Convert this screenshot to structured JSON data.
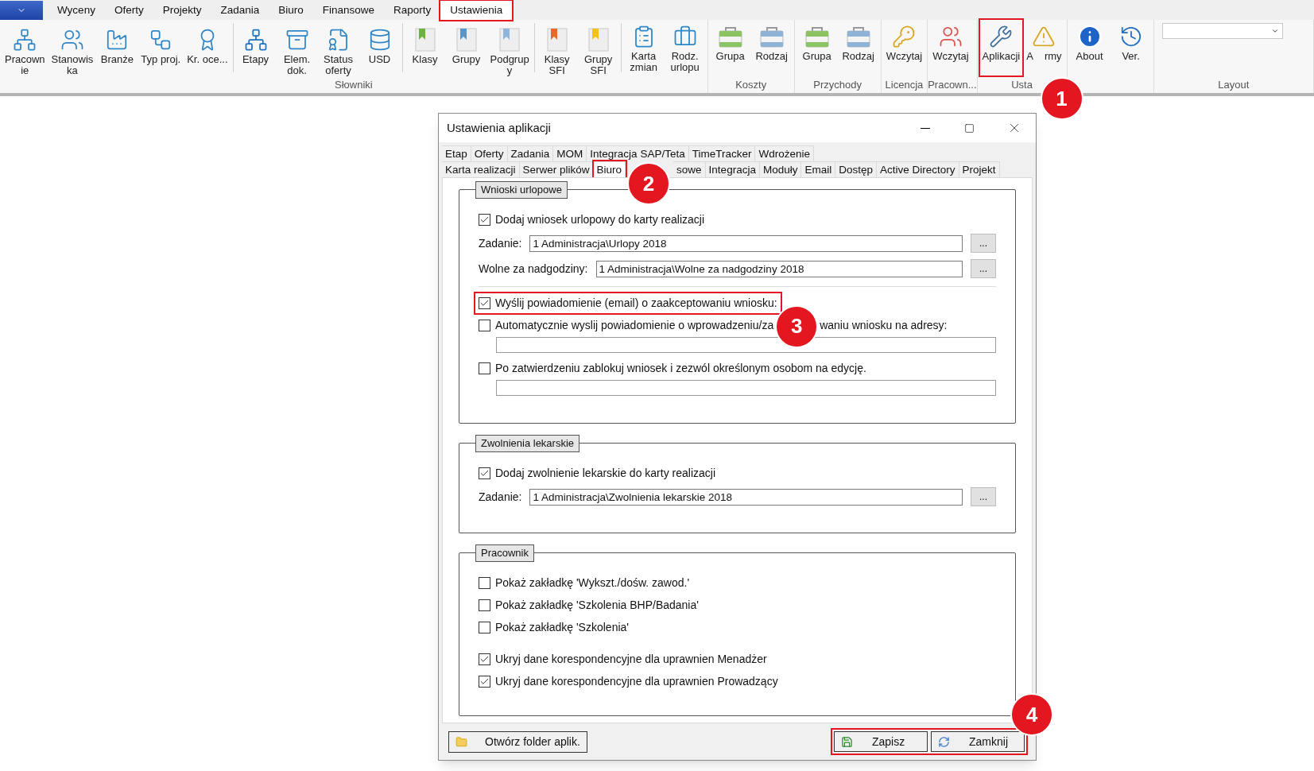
{
  "menu": {
    "tabs": [
      {
        "label": "Wyceny",
        "selected": false,
        "highlighted": false
      },
      {
        "label": "Oferty",
        "selected": false,
        "highlighted": false
      },
      {
        "label": "Projekty",
        "selected": false,
        "highlighted": false
      },
      {
        "label": "Zadania",
        "selected": false,
        "highlighted": false
      },
      {
        "label": "Biuro",
        "selected": false,
        "highlighted": false
      },
      {
        "label": "Finansowe",
        "selected": false,
        "highlighted": false
      },
      {
        "label": "Raporty",
        "selected": false,
        "highlighted": false
      },
      {
        "label": "Ustawienia",
        "selected": true,
        "highlighted": true
      }
    ]
  },
  "ribbon": {
    "groups": [
      {
        "label": "Słowniki",
        "subgroups": [
          [
            {
              "label": "Pracown\nie",
              "highlighted": false
            },
            {
              "label": "Stanowis\nka",
              "highlighted": false
            },
            {
              "label": "Branże",
              "highlighted": false
            },
            {
              "label": "Typ proj.",
              "highlighted": false
            },
            {
              "label": "Kr. oce...",
              "highlighted": false
            }
          ],
          [
            {
              "label": "Etapy",
              "highlighted": false
            },
            {
              "label": "Elem.\ndok.",
              "highlighted": false
            },
            {
              "label": "Status\noferty",
              "highlighted": false
            },
            {
              "label": "USD",
              "highlighted": false
            }
          ],
          [
            {
              "label": "Klasy",
              "highlighted": false
            },
            {
              "label": "Grupy",
              "highlighted": false
            },
            {
              "label": "Podgrup\ny",
              "highlighted": false
            }
          ],
          [
            {
              "label": "Klasy\nSFI",
              "highlighted": false
            },
            {
              "label": "Grupy\nSFI",
              "highlighted": false
            }
          ],
          [
            {
              "label": "Karta\nzmian",
              "highlighted": false
            },
            {
              "label": "Rodz.\nurlopu",
              "highlighted": false
            }
          ]
        ]
      },
      {
        "label": "Koszty",
        "subgroups": [
          [
            {
              "label": "Grupa",
              "highlighted": false
            },
            {
              "label": "Rodzaj",
              "highlighted": false
            }
          ]
        ]
      },
      {
        "label": "Przychody",
        "subgroups": [
          [
            {
              "label": "Grupa",
              "highlighted": false
            },
            {
              "label": "Rodzaj",
              "highlighted": false
            }
          ]
        ]
      },
      {
        "label": "Licencja",
        "subgroups": [
          [
            {
              "label": "Wczytaj",
              "highlighted": false
            }
          ]
        ]
      },
      {
        "label": "Pracown...",
        "subgroups": [
          [
            {
              "label": "Wczytaj",
              "highlighted": false
            }
          ]
        ]
      },
      {
        "label": "Usta",
        "subgroups": [
          [
            {
              "label": "Aplikacji",
              "highlighted": true,
              "callout": "1"
            },
            {
              "label_parts": [
                "A",
                "rmy"
              ],
              "highlighted": false
            }
          ]
        ]
      },
      {
        "subgroups": [
          [
            {
              "label": "About",
              "highlighted": false
            },
            {
              "label": "Ver.",
              "highlighted": false
            }
          ]
        ]
      },
      {
        "label": "Layout",
        "combo": true
      }
    ]
  },
  "dialog": {
    "title": "Ustawienia aplikacji",
    "tab_rows": [
      [
        {
          "label": "Etap",
          "selected": false,
          "highlighted": false
        },
        {
          "label": "Oferty",
          "selected": false,
          "highlighted": false
        },
        {
          "label": "Zadania",
          "selected": false,
          "highlighted": false
        },
        {
          "label": "MOM",
          "selected": false,
          "highlighted": false
        },
        {
          "label": "Integracja SAP/Teta",
          "selected": false,
          "highlighted": false
        },
        {
          "label": "TimeTracker",
          "selected": false,
          "highlighted": false
        },
        {
          "label": "Wdrożenie",
          "selected": false,
          "highlighted": false
        }
      ],
      [
        {
          "label": "Karta realizacji",
          "selected": false,
          "highlighted": false
        },
        {
          "label": "Serwer plików",
          "selected": false,
          "highlighted": false
        },
        {
          "label": "Biuro",
          "selected": true,
          "highlighted": true
        },
        {
          "label": "sowe",
          "selected": false,
          "highlighted": false,
          "callout": "2"
        },
        {
          "label": "Integracja",
          "selected": false,
          "highlighted": false
        },
        {
          "label": "Moduły",
          "selected": false,
          "highlighted": false
        },
        {
          "label": "Email",
          "selected": false,
          "highlighted": false
        },
        {
          "label": "Dostęp",
          "selected": false,
          "highlighted": false
        },
        {
          "label": "Active Directory",
          "selected": false,
          "highlighted": false
        },
        {
          "label": "Projekt",
          "selected": false,
          "highlighted": false
        }
      ]
    ],
    "groups": [
      {
        "title": "Wnioski urlopowe",
        "rows": [
          {
            "kind": "checkbox",
            "label": "Dodaj wniosek urlopowy do karty realizacji",
            "checked": true,
            "highlighted": false
          },
          {
            "kind": "field",
            "label": "Zadanie:",
            "value": "1 Administracja\\Urlopy 2018",
            "button": "..."
          },
          {
            "kind": "field",
            "label": "Wolne za nadgodziny:",
            "value": "1 Administracja\\Wolne za nadgodziny 2018",
            "button": "..."
          },
          {
            "kind": "divider"
          },
          {
            "kind": "checkbox",
            "label": "Wyślij powiadomienie (email) o zaakceptowaniu wniosku:",
            "checked": true,
            "highlighted": true
          },
          {
            "kind": "checkbox",
            "label_parts": [
              "Automatycznie wyslij powiadomienie o wprowadzeniu/za",
              "waniu wniosku na adresy:"
            ],
            "callout": "3",
            "checked": false,
            "highlighted": false
          },
          {
            "kind": "input"
          },
          {
            "kind": "checkbox",
            "label": "Po zatwierdzeniu zablokuj wniosek i zezwól określonym osobom na edycję.",
            "checked": false,
            "highlighted": false
          },
          {
            "kind": "input"
          }
        ]
      },
      {
        "title": "Zwolnienia lekarskie",
        "rows": [
          {
            "kind": "checkbox",
            "label": "Dodaj zwolnienie lekarskie do karty realizacji",
            "checked": true,
            "highlighted": false
          },
          {
            "kind": "field",
            "label": "Zadanie:",
            "value": "1 Administracja\\Zwolnienia lekarskie 2018",
            "button": "..."
          }
        ]
      },
      {
        "title": "Pracownik",
        "rows": [
          {
            "kind": "checkbox",
            "label": "Pokaż zakładkę 'Wykszt./dośw. zawod.'",
            "checked": false,
            "highlighted": false
          },
          {
            "kind": "checkbox",
            "label": "Pokaż zakładkę 'Szkolenia BHP/Badania'",
            "checked": false,
            "highlighted": false
          },
          {
            "kind": "checkbox",
            "label": "Pokaż zakładkę 'Szkolenia'",
            "checked": false,
            "highlighted": false
          },
          {
            "kind": "spacer"
          },
          {
            "kind": "checkbox",
            "label": "Ukryj dane korespondencyjne dla uprawnien Menadżer",
            "checked": true,
            "highlighted": false
          },
          {
            "kind": "checkbox",
            "label": "Ukryj dane korespondencyjne dla uprawnien Prowadzący",
            "checked": true,
            "highlighted": false
          }
        ]
      }
    ],
    "footer": {
      "open_folder": "Otwórz folder aplik.",
      "actions": {
        "highlighted": true,
        "callout": "4",
        "buttons": [
          "Zapisz",
          "Zamknij"
        ]
      }
    }
  }
}
